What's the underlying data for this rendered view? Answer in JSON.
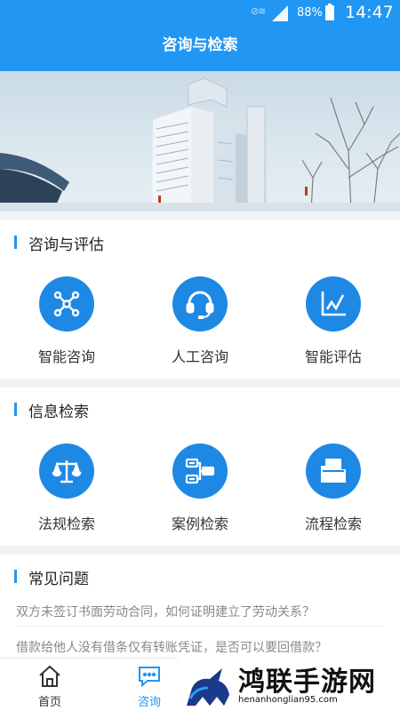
{
  "status_bar": {
    "battery": "88%",
    "time": "14:47"
  },
  "header": {
    "title": "咨询与检索"
  },
  "sections": {
    "consult": {
      "title": "咨询与评估",
      "items": [
        {
          "label": "智能咨询",
          "icon": "network-icon"
        },
        {
          "label": "人工咨询",
          "icon": "headset-icon"
        },
        {
          "label": "智能评估",
          "icon": "line-chart-icon"
        }
      ]
    },
    "search": {
      "title": "信息检索",
      "items": [
        {
          "label": "法规检索",
          "icon": "scales-icon"
        },
        {
          "label": "案例检索",
          "icon": "flowchart-icon"
        },
        {
          "label": "流程检索",
          "icon": "folder-icon"
        }
      ]
    },
    "faq": {
      "title": "常见问题",
      "items": [
        "双方未签订书面劳动合同，如何证明建立了劳动关系？",
        "借款给他人没有借条仅有转账凭证，是否可以要回借款？"
      ]
    }
  },
  "tabbar": {
    "tabs": [
      {
        "label": "首页",
        "icon": "home-icon",
        "color": "#333333"
      },
      {
        "label": "咨询",
        "icon": "chat-icon",
        "color": "#2196f3"
      }
    ]
  },
  "watermark": {
    "title": "鸿联手游网",
    "url": "henanhonglian95.com"
  },
  "colors": {
    "accent": "#2196f3",
    "icon_bg": "#1e88e5"
  }
}
